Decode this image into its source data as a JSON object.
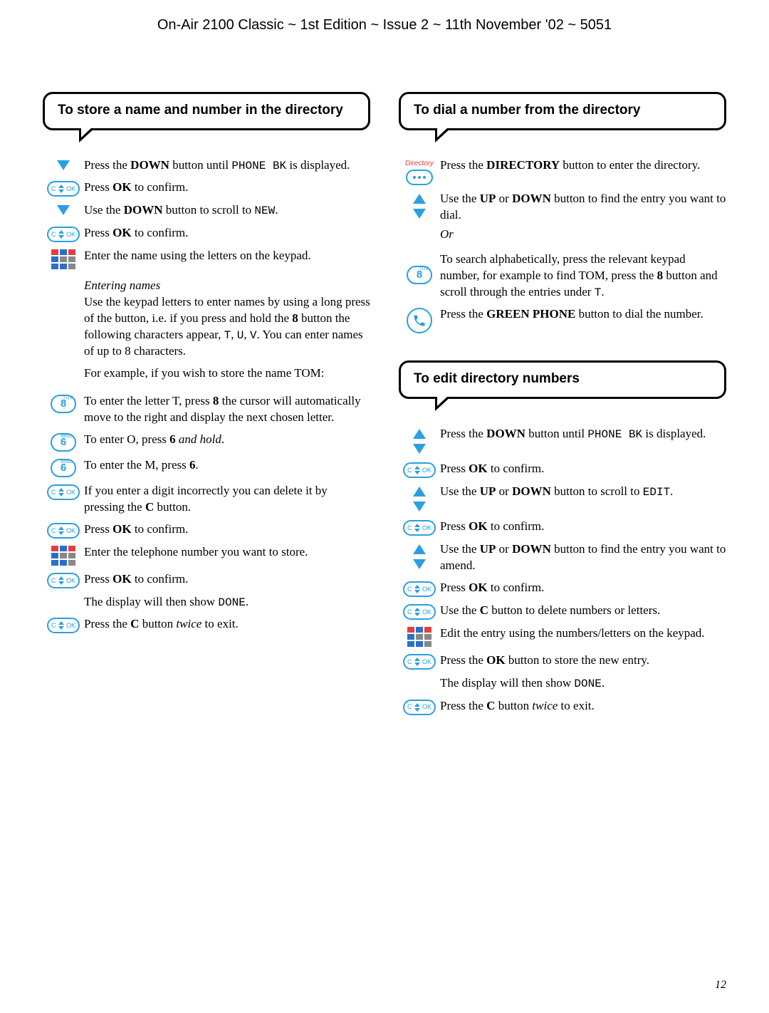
{
  "header": "On-Air 2100 Classic ~ 1st Edition ~ Issue 2 ~ 11th November '02 ~ 5051",
  "page_number": "12",
  "left": {
    "title": "To store a name and number in the directory",
    "s1_a": "Press the ",
    "s1_b": "DOWN",
    "s1_c": " button until ",
    "s1_d": "PHONE BK",
    "s1_e": " is displayed.",
    "s2_a": "Press ",
    "s2_b": "OK",
    "s2_c": " to confirm.",
    "s3_a": "Use the ",
    "s3_b": "DOWN",
    "s3_c": " button to scroll to ",
    "s3_d": "NEW",
    "s3_e": ".",
    "s4_a": "Press ",
    "s4_b": "OK",
    "s4_c": " to confirm.",
    "s5": "Enter the name using the letters on the keypad.",
    "subhead": "Entering names",
    "p1_a": "Use the keypad letters to enter names by using a long press of the button, i.e. if you press and hold the ",
    "p1_b": "8",
    "p1_c": " button the following characters appear, ",
    "p1_d": "T",
    "p1_e": ", ",
    "p1_f": "U",
    "p1_g": ", ",
    "p1_h": "V",
    "p1_i": ". You can enter names of up to 8 characters.",
    "p2": "For example, if you wish to store the name TOM:",
    "s6_a": "To enter the letter T, press ",
    "s6_b": "8",
    "s6_c": " the cursor will automatically move to the right and display the next chosen letter.",
    "s7_a": "To enter O, press ",
    "s7_b": "6",
    "s7_c": " and hold",
    "s7_d": ".",
    "s8_a": "To enter the M, press ",
    "s8_b": "6",
    "s8_c": ".",
    "s9_a": "If you enter a digit incorrectly you can delete it by pressing the ",
    "s9_b": "C",
    "s9_c": " button.",
    "s10_a": "Press ",
    "s10_b": "OK",
    "s10_c": " to confirm.",
    "s11": "Enter the telephone number you want to store.",
    "s12_a": "Press ",
    "s12_b": "OK",
    "s12_c": " to confirm.",
    "s13_a": "The display will then show ",
    "s13_b": "DONE",
    "s13_c": ".",
    "s14_a": "Press the ",
    "s14_b": "C",
    "s14_c": " button ",
    "s14_d": "twice",
    "s14_e": " to exit.",
    "key8": "8",
    "key8sup": "TUV",
    "key6": "6",
    "key6sup": "MNO"
  },
  "right": {
    "title1": "To dial a number from the directory",
    "dir_label": "Directory",
    "d1_a": "Press the ",
    "d1_b": "DIRECTORY",
    "d1_c": " button to enter the directory.",
    "d2_a": "Use the ",
    "d2_b": "UP",
    "d2_c": " or ",
    "d2_d": "DOWN",
    "d2_e": " button to find the entry you want to dial.",
    "or": "Or",
    "d3_a": "To search alphabetically, press the relevant keypad number, for example to find TOM, press the ",
    "d3_b": "8",
    "d3_c": " button and scroll through the entries under ",
    "d3_d": "T",
    "d3_e": ".",
    "d4_a": "Press the ",
    "d4_b": "GREEN PHONE",
    "d4_c": " button to dial the number.",
    "title2": "To edit directory numbers",
    "e1_a": "Press the ",
    "e1_b": "DOWN",
    "e1_c": " button until ",
    "e1_d": "PHONE BK",
    "e1_e": " is displayed.",
    "e2_a": "Press ",
    "e2_b": "OK",
    "e2_c": " to confirm.",
    "e3_a": "Use the ",
    "e3_b": "UP",
    "e3_c": " or ",
    "e3_d": "DOWN",
    "e3_e": " button to scroll to ",
    "e3_f": "EDIT",
    "e3_g": ".",
    "e4_a": "Press ",
    "e4_b": "OK",
    "e4_c": " to confirm.",
    "e5_a": "Use the ",
    "e5_b": "UP",
    "e5_c": " or ",
    "e5_d": "DOWN",
    "e5_e": " button to find the entry you want to amend.",
    "e6_a": "Press ",
    "e6_b": "OK",
    "e6_c": " to confirm.",
    "e7_a": "Use the ",
    "e7_b": "C",
    "e7_c": " button to delete numbers or letters.",
    "e8": "Edit the entry using the numbers/letters on the keypad.",
    "e9_a": "Press the ",
    "e9_b": "OK",
    "e9_c": " button to store the new entry.",
    "e10_a": "The display will then show ",
    "e10_b": "DONE",
    "e10_c": ".",
    "e11_a": "Press the ",
    "e11_b": "C",
    "e11_c": " button ",
    "e11_d": "twice",
    "e11_e": " to exit.",
    "key8": "8",
    "key8sup": "TUV"
  }
}
